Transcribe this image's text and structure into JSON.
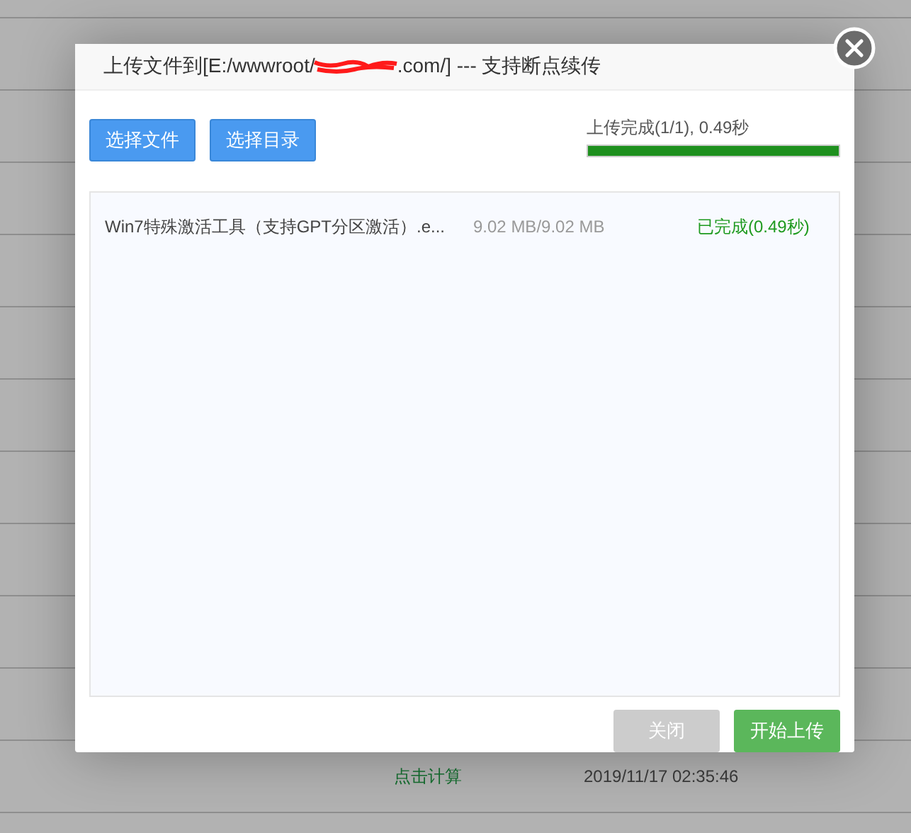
{
  "background_table": {
    "rows": [
      {
        "action": "点击计算",
        "time": "2019/11/17 02:35:46"
      }
    ]
  },
  "dialog": {
    "title_start": "上传文件到[E:/wwwroot/",
    "title_redacted": true,
    "title_end": ".com/] --- 支持断点续传",
    "pick_buttons": [
      "选择文件",
      "选择目录"
    ],
    "progress": {
      "text": "上传完成(1/1), 0.49秒",
      "level": 1
    },
    "files": [
      {
        "name": "Win7特殊激活工具（支持GPT分区激活）.e...",
        "size": "9.02 MB/9.02 MB",
        "status": "已完成(0.49秒)",
        "kind": "done"
      }
    ],
    "footer_buttons": [
      {
        "label": "关闭",
        "disabled": true
      },
      {
        "label": "开始上传",
        "disabled": false
      }
    ]
  }
}
